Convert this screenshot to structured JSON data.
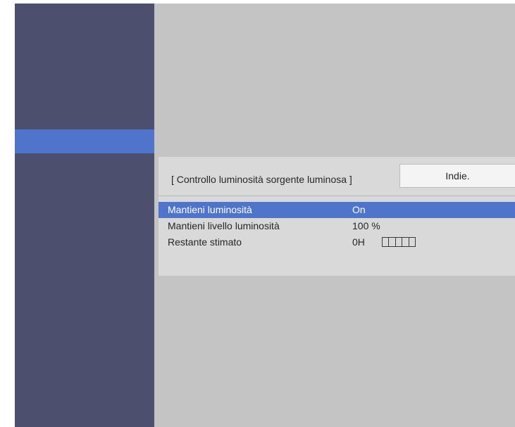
{
  "colors": {
    "sidebar_bg": "#4c4f6e",
    "selection": "#4f74cc",
    "content_bg": "#c4c4c4",
    "dialog_bg": "#d9d9d9"
  },
  "dialog": {
    "title": "[ Controllo luminosità sorgente luminosa ]",
    "back_label": "Indie.",
    "rows": [
      {
        "label": "Mantieni luminosità",
        "value": "On",
        "selected": true
      },
      {
        "label": "Mantieni livello luminosità",
        "value": "100 %",
        "selected": false
      },
      {
        "label": "Restante stimato",
        "value": "0H",
        "selected": false,
        "remaining_bar": {
          "segments": 5,
          "filled": 0
        }
      }
    ]
  }
}
